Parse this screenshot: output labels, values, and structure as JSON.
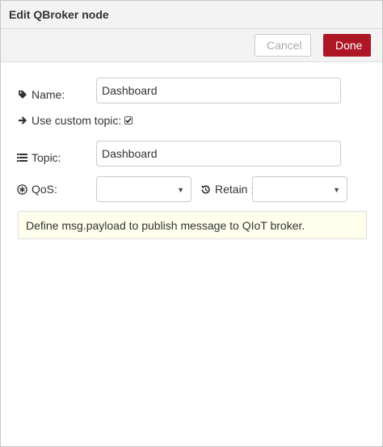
{
  "dialog": {
    "title": "Edit QBroker node"
  },
  "toolbar": {
    "cancel_label": "Cancel",
    "done_label": "Done"
  },
  "form": {
    "name": {
      "label": "Name:",
      "value": "Dashboard",
      "icon": "tag-icon"
    },
    "custom_topic": {
      "label": "Use custom topic:",
      "checked": true,
      "icon": "arrow-right-icon"
    },
    "topic": {
      "label": "Topic:",
      "value": "Dashboard",
      "icon": "list-icon"
    },
    "qos": {
      "label": "QoS:",
      "value": "",
      "icon": "asterisk-circle-icon"
    },
    "retain": {
      "label": "Retain :",
      "value": "",
      "icon": "history-icon"
    }
  },
  "tip": {
    "text": "Define msg.payload to publish message to QIoT broker."
  },
  "colors": {
    "accent": "#ad1625",
    "header_bg": "#f3f3f3",
    "tip_bg": "#ffffee"
  }
}
